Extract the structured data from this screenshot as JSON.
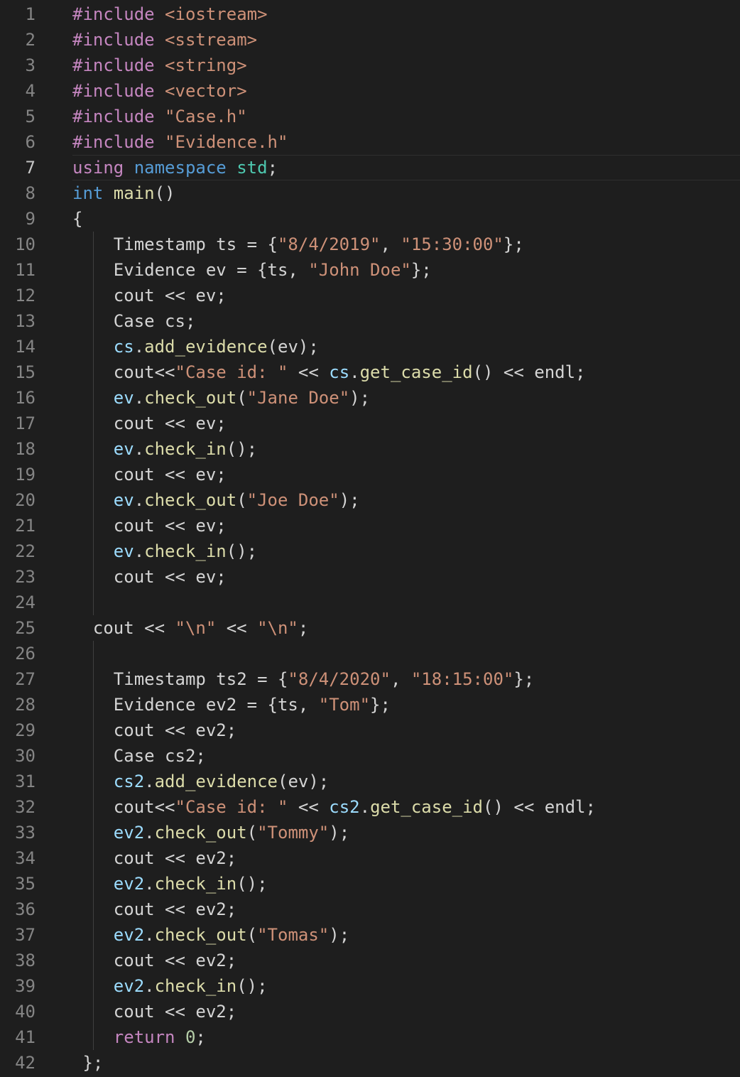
{
  "colors": {
    "background": "#1e1e1e",
    "line_number": "#858585",
    "line_number_active": "#c6c6c6",
    "keyword": "#c586c0",
    "type": "#569cd6",
    "string": "#ce9178",
    "namespace": "#4ec9b0",
    "variable": "#9cdcfe",
    "function": "#dcdcaa",
    "number": "#b5cea8",
    "text": "#d4d4d4"
  },
  "active_line": 7,
  "lines": [
    {
      "n": "1",
      "indent": 0,
      "tokens": [
        [
          "kw",
          "#include "
        ],
        [
          "str",
          "<iostream>"
        ]
      ]
    },
    {
      "n": "2",
      "indent": 0,
      "tokens": [
        [
          "kw",
          "#include "
        ],
        [
          "str",
          "<sstream>"
        ]
      ]
    },
    {
      "n": "3",
      "indent": 0,
      "tokens": [
        [
          "kw",
          "#include "
        ],
        [
          "str",
          "<string>"
        ]
      ]
    },
    {
      "n": "4",
      "indent": 0,
      "tokens": [
        [
          "kw",
          "#include "
        ],
        [
          "str",
          "<vector>"
        ]
      ]
    },
    {
      "n": "5",
      "indent": 0,
      "tokens": [
        [
          "kw",
          "#include "
        ],
        [
          "str",
          "\"Case.h\""
        ]
      ]
    },
    {
      "n": "6",
      "indent": 0,
      "tokens": [
        [
          "kw",
          "#include "
        ],
        [
          "str",
          "\"Evidence.h\""
        ]
      ]
    },
    {
      "n": "7",
      "indent": 0,
      "tokens": [
        [
          "kw",
          "using "
        ],
        [
          "type",
          "namespace "
        ],
        [
          "ns",
          "std"
        ],
        [
          "txt",
          ";"
        ]
      ]
    },
    {
      "n": "8",
      "indent": 0,
      "tokens": [
        [
          "type",
          "int "
        ],
        [
          "fn",
          "main"
        ],
        [
          "txt",
          "()"
        ]
      ]
    },
    {
      "n": "9",
      "indent": 0,
      "tokens": [
        [
          "txt",
          "{"
        ]
      ]
    },
    {
      "n": "10",
      "indent": 4,
      "tokens": [
        [
          "txt",
          "Timestamp ts = {"
        ],
        [
          "str",
          "\"8/4/2019\""
        ],
        [
          "txt",
          ", "
        ],
        [
          "str",
          "\"15:30:00\""
        ],
        [
          "txt",
          "};"
        ]
      ]
    },
    {
      "n": "11",
      "indent": 4,
      "tokens": [
        [
          "txt",
          "Evidence ev = {ts, "
        ],
        [
          "str",
          "\"John Doe\""
        ],
        [
          "txt",
          "};"
        ]
      ]
    },
    {
      "n": "12",
      "indent": 4,
      "tokens": [
        [
          "txt",
          "cout << ev;"
        ]
      ]
    },
    {
      "n": "13",
      "indent": 4,
      "tokens": [
        [
          "txt",
          "Case cs;"
        ]
      ]
    },
    {
      "n": "14",
      "indent": 4,
      "tokens": [
        [
          "var",
          "cs"
        ],
        [
          "txt",
          "."
        ],
        [
          "fn",
          "add_evidence"
        ],
        [
          "txt",
          "(ev);"
        ]
      ]
    },
    {
      "n": "15",
      "indent": 4,
      "tokens": [
        [
          "txt",
          "cout<<"
        ],
        [
          "str",
          "\"Case id: \""
        ],
        [
          "txt",
          " << "
        ],
        [
          "var",
          "cs"
        ],
        [
          "txt",
          "."
        ],
        [
          "fn",
          "get_case_id"
        ],
        [
          "txt",
          "() << endl;"
        ]
      ]
    },
    {
      "n": "16",
      "indent": 4,
      "tokens": [
        [
          "var",
          "ev"
        ],
        [
          "txt",
          "."
        ],
        [
          "fn",
          "check_out"
        ],
        [
          "txt",
          "("
        ],
        [
          "str",
          "\"Jane Doe\""
        ],
        [
          "txt",
          ");"
        ]
      ]
    },
    {
      "n": "17",
      "indent": 4,
      "tokens": [
        [
          "txt",
          "cout << ev;"
        ]
      ]
    },
    {
      "n": "18",
      "indent": 4,
      "tokens": [
        [
          "var",
          "ev"
        ],
        [
          "txt",
          "."
        ],
        [
          "fn",
          "check_in"
        ],
        [
          "txt",
          "();"
        ]
      ]
    },
    {
      "n": "19",
      "indent": 4,
      "tokens": [
        [
          "txt",
          "cout << ev;"
        ]
      ]
    },
    {
      "n": "20",
      "indent": 4,
      "tokens": [
        [
          "var",
          "ev"
        ],
        [
          "txt",
          "."
        ],
        [
          "fn",
          "check_out"
        ],
        [
          "txt",
          "("
        ],
        [
          "str",
          "\"Joe Doe\""
        ],
        [
          "txt",
          ");"
        ]
      ]
    },
    {
      "n": "21",
      "indent": 4,
      "tokens": [
        [
          "txt",
          "cout << ev;"
        ]
      ]
    },
    {
      "n": "22",
      "indent": 4,
      "tokens": [
        [
          "var",
          "ev"
        ],
        [
          "txt",
          "."
        ],
        [
          "fn",
          "check_in"
        ],
        [
          "txt",
          "();"
        ]
      ]
    },
    {
      "n": "23",
      "indent": 4,
      "tokens": [
        [
          "txt",
          "cout << ev;"
        ]
      ]
    },
    {
      "n": "24",
      "indent": 4,
      "tokens": []
    },
    {
      "n": "25",
      "indent": 2,
      "tokens": [
        [
          "txt",
          "cout << "
        ],
        [
          "str",
          "\"\\n\""
        ],
        [
          "txt",
          " << "
        ],
        [
          "str",
          "\"\\n\""
        ],
        [
          "txt",
          ";"
        ]
      ]
    },
    {
      "n": "26",
      "indent": 4,
      "tokens": []
    },
    {
      "n": "27",
      "indent": 4,
      "tokens": [
        [
          "txt",
          "Timestamp ts2 = {"
        ],
        [
          "str",
          "\"8/4/2020\""
        ],
        [
          "txt",
          ", "
        ],
        [
          "str",
          "\"18:15:00\""
        ],
        [
          "txt",
          "};"
        ]
      ]
    },
    {
      "n": "28",
      "indent": 4,
      "tokens": [
        [
          "txt",
          "Evidence ev2 = {ts, "
        ],
        [
          "str",
          "\"Tom\""
        ],
        [
          "txt",
          "};"
        ]
      ]
    },
    {
      "n": "29",
      "indent": 4,
      "tokens": [
        [
          "txt",
          "cout << ev2;"
        ]
      ]
    },
    {
      "n": "30",
      "indent": 4,
      "tokens": [
        [
          "txt",
          "Case cs2;"
        ]
      ]
    },
    {
      "n": "31",
      "indent": 4,
      "tokens": [
        [
          "var",
          "cs2"
        ],
        [
          "txt",
          "."
        ],
        [
          "fn",
          "add_evidence"
        ],
        [
          "txt",
          "(ev);"
        ]
      ]
    },
    {
      "n": "32",
      "indent": 4,
      "tokens": [
        [
          "txt",
          "cout<<"
        ],
        [
          "str",
          "\"Case id: \""
        ],
        [
          "txt",
          " << "
        ],
        [
          "var",
          "cs2"
        ],
        [
          "txt",
          "."
        ],
        [
          "fn",
          "get_case_id"
        ],
        [
          "txt",
          "() << endl;"
        ]
      ]
    },
    {
      "n": "33",
      "indent": 4,
      "tokens": [
        [
          "var",
          "ev2"
        ],
        [
          "txt",
          "."
        ],
        [
          "fn",
          "check_out"
        ],
        [
          "txt",
          "("
        ],
        [
          "str",
          "\"Tommy\""
        ],
        [
          "txt",
          ");"
        ]
      ]
    },
    {
      "n": "34",
      "indent": 4,
      "tokens": [
        [
          "txt",
          "cout << ev2;"
        ]
      ]
    },
    {
      "n": "35",
      "indent": 4,
      "tokens": [
        [
          "var",
          "ev2"
        ],
        [
          "txt",
          "."
        ],
        [
          "fn",
          "check_in"
        ],
        [
          "txt",
          "();"
        ]
      ]
    },
    {
      "n": "36",
      "indent": 4,
      "tokens": [
        [
          "txt",
          "cout << ev2;"
        ]
      ]
    },
    {
      "n": "37",
      "indent": 4,
      "tokens": [
        [
          "var",
          "ev2"
        ],
        [
          "txt",
          "."
        ],
        [
          "fn",
          "check_out"
        ],
        [
          "txt",
          "("
        ],
        [
          "str",
          "\"Tomas\""
        ],
        [
          "txt",
          ");"
        ]
      ]
    },
    {
      "n": "38",
      "indent": 4,
      "tokens": [
        [
          "txt",
          "cout << ev2;"
        ]
      ]
    },
    {
      "n": "39",
      "indent": 4,
      "tokens": [
        [
          "var",
          "ev2"
        ],
        [
          "txt",
          "."
        ],
        [
          "fn",
          "check_in"
        ],
        [
          "txt",
          "();"
        ]
      ]
    },
    {
      "n": "40",
      "indent": 4,
      "tokens": [
        [
          "txt",
          "cout << ev2;"
        ]
      ]
    },
    {
      "n": "41",
      "indent": 4,
      "tokens": [
        [
          "kw",
          "return "
        ],
        [
          "num",
          "0"
        ],
        [
          "txt",
          ";"
        ]
      ]
    },
    {
      "n": "42",
      "indent": 1,
      "tokens": [
        [
          "txt",
          "};"
        ]
      ]
    }
  ]
}
